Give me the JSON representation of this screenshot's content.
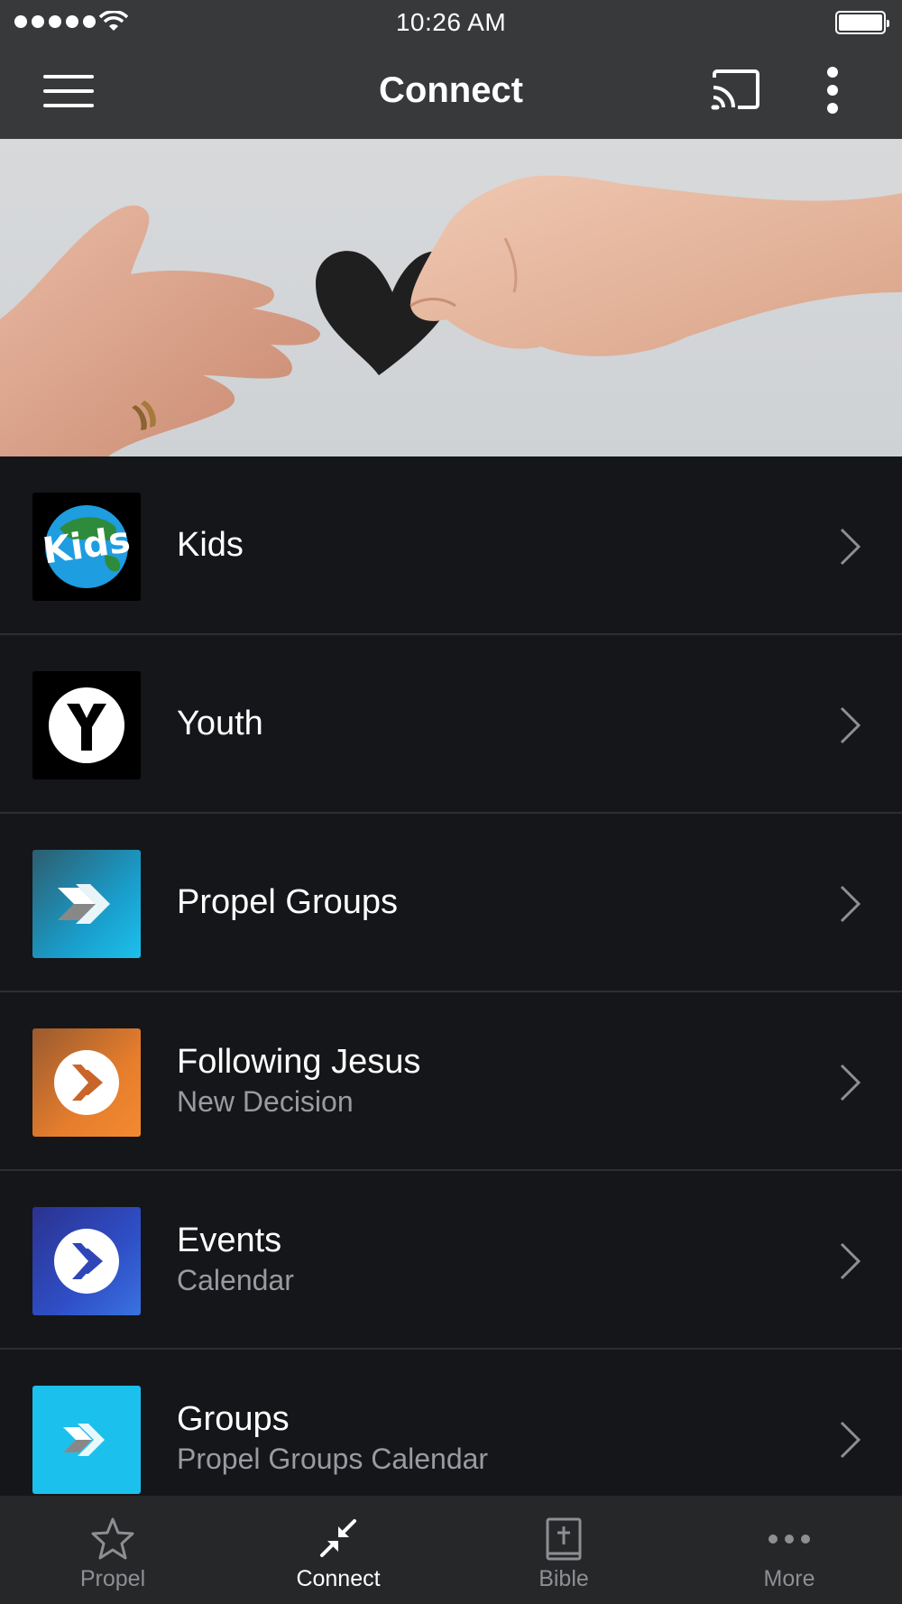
{
  "status_bar": {
    "time": "10:26 AM",
    "signal_bars": 5,
    "battery_level": 1.0
  },
  "nav": {
    "title": "Connect",
    "icons": [
      "menu-icon",
      "cast-icon",
      "more-vertical-icon"
    ]
  },
  "hero": {
    "description_icon": "hands-heart-image"
  },
  "list": {
    "items": [
      {
        "title": "Kids",
        "subtitle": "",
        "icon": "kids-logo-icon"
      },
      {
        "title": "Youth",
        "subtitle": "",
        "icon": "youth-logo-icon"
      },
      {
        "title": "Propel Groups",
        "subtitle": "",
        "icon": "propel-logo-icon"
      },
      {
        "title": "Following Jesus",
        "subtitle": "New Decision",
        "icon": "following-jesus-icon"
      },
      {
        "title": "Events",
        "subtitle": "Calendar",
        "icon": "events-icon"
      },
      {
        "title": "Groups",
        "subtitle": "Propel Groups Calendar",
        "icon": "groups-icon"
      }
    ]
  },
  "tabs": [
    {
      "label": "Propel",
      "icon": "star-icon",
      "active": false
    },
    {
      "label": "Connect",
      "icon": "connect-arrows-icon",
      "active": true
    },
    {
      "label": "Bible",
      "icon": "bible-icon",
      "active": false
    },
    {
      "label": "More",
      "icon": "more-horizontal-icon",
      "active": false
    }
  ],
  "colors": {
    "bar_background": "#38393b",
    "list_background": "#151619",
    "tab_bar_background": "#262729",
    "subtitle_gray": "#9a9ba0",
    "orange_accent": "#e57d2d",
    "blue_accent": "#1cc0ec"
  }
}
